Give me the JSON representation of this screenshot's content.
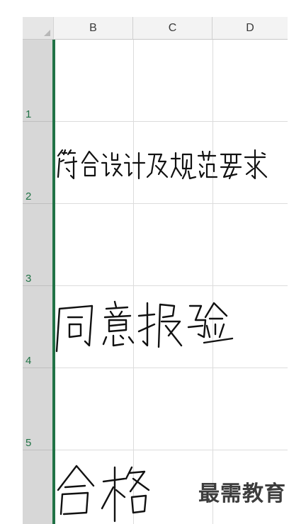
{
  "spreadsheet": {
    "columns": [
      "B",
      "C",
      "D"
    ],
    "rows": [
      "1",
      "2",
      "3",
      "4",
      "5"
    ],
    "selected_column_color": "#217346",
    "cells": {
      "B2": "符合设计及规范要求",
      "B4": "同意报验",
      "B6": "合格"
    }
  },
  "watermark": {
    "text": "最需教育"
  }
}
